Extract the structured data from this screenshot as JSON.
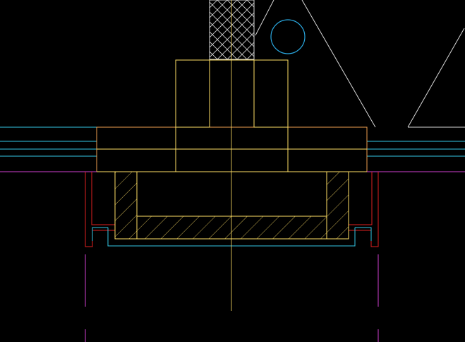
{
  "colors": {
    "background": "#000000",
    "yellow": "#ffe066",
    "orange": "#f0a050",
    "cyan": "#33c8e6",
    "red": "#e02020",
    "magenta": "#d040d0",
    "white": "#d8d8d8",
    "blue": "#2aa8e0"
  },
  "layers": [
    "yellow",
    "orange",
    "cyan",
    "red",
    "magenta",
    "white"
  ]
}
